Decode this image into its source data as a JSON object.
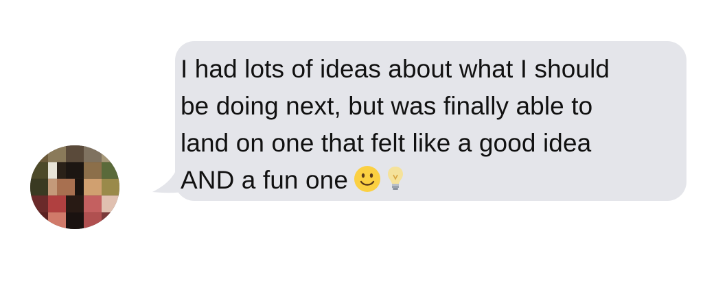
{
  "message": {
    "lines": [
      "I had lots of ideas about what I should",
      "be doing next, but was finally able to",
      "land on one that felt like a good idea",
      "AND a fun one"
    ],
    "emojis": [
      "slightly-smiling-face-icon",
      "light-bulb-icon"
    ]
  },
  "colors": {
    "bubble": "#e4e5ea",
    "text": "#111111"
  }
}
